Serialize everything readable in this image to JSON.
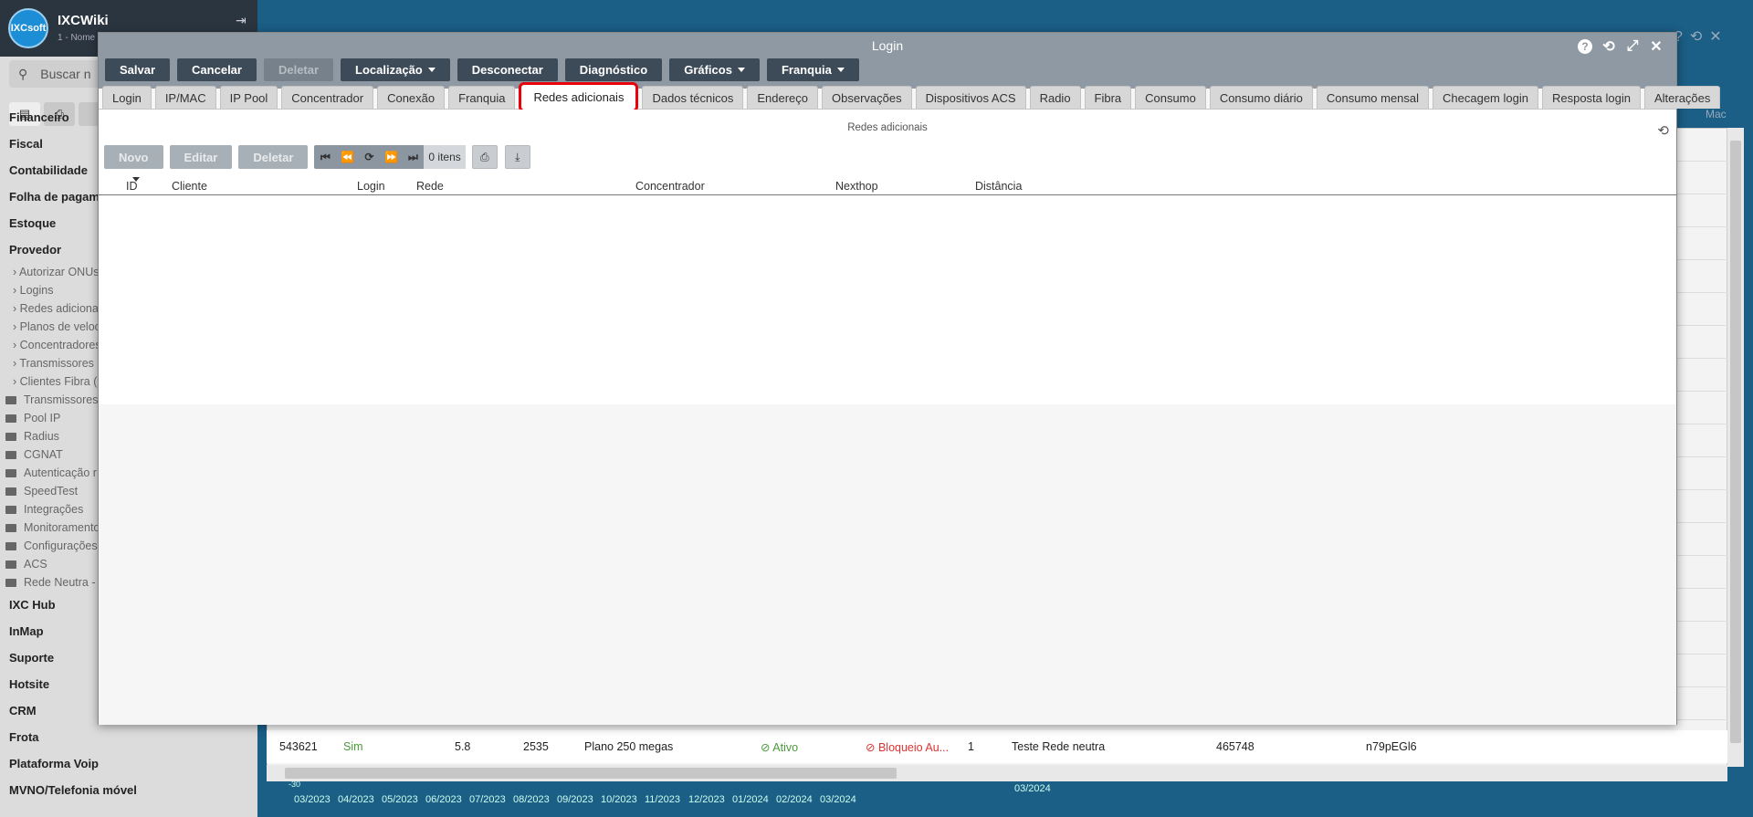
{
  "background": {
    "app_name": "IXCWiki",
    "app_subtitle": "1 - Nome",
    "logo_text": "IXCsoft",
    "search_placeholder": "Buscar n",
    "menu_main_top": [
      "Financeiro",
      "Fiscal",
      "Contabilidade",
      "Folha de pagame",
      "Estoque",
      "Provedor"
    ],
    "menu_sub": [
      "Autorizar ONUs",
      "Logins",
      "Redes adicionais",
      "Planos de veloci",
      "Concentradores",
      "Transmissores (",
      "Clientes Fibra (C"
    ],
    "menu_folders": [
      "Transmissores",
      "Pool IP",
      "Radius",
      "CGNAT",
      "Autenticação r",
      "SpeedTest",
      "Integrações",
      "Monitoramento",
      "Configurações",
      "ACS",
      "Rede Neutra -"
    ],
    "menu_main_bottom": [
      "IXC Hub",
      "InMap",
      "Suporte",
      "Hotsite",
      "CRM",
      "Frota",
      "Plataforma Voip",
      "MVNO/Telefonia móvel"
    ],
    "grid_header_right": "Mac",
    "last_row": {
      "id": "543621",
      "sim": "Sim",
      "v1": "5.8",
      "v2": "2535",
      "plano": "Plano 250 megas",
      "ativo": "Ativo",
      "bloqueio": "Bloqueio Au...",
      "n": "1",
      "rede": "Teste Rede neutra",
      "num": "465748",
      "code": "n79pEGl6"
    },
    "axis_labels": [
      "03/2023",
      "04/2023",
      "05/2023",
      "06/2023",
      "07/2023",
      "08/2023",
      "09/2023",
      "10/2023",
      "11/2023",
      "12/2023",
      "01/2024",
      "02/2024",
      "03/2024"
    ],
    "axis_extra": "03/2024",
    "axis_neg": "-30"
  },
  "modal": {
    "title": "Login",
    "toolbar": {
      "salvar": "Salvar",
      "cancelar": "Cancelar",
      "deletar": "Deletar",
      "localizacao": "Localização",
      "desconectar": "Desconectar",
      "diagnostico": "Diagnóstico",
      "graficos": "Gráficos",
      "franquia": "Franquia"
    },
    "tabs": [
      "Login",
      "IP/MAC",
      "IP Pool",
      "Concentrador",
      "Conexão",
      "Franquia",
      "Redes adicionais",
      "Dados técnicos",
      "Endereço",
      "Observações",
      "Dispositivos ACS",
      "Radio",
      "Fibra",
      "Consumo",
      "Consumo diário",
      "Consumo mensal",
      "Checagem login",
      "Resposta login",
      "Alterações"
    ],
    "active_tab": "Redes adicionais",
    "panel": {
      "title": "Redes adicionais",
      "buttons": {
        "novo": "Novo",
        "editar": "Editar",
        "deletar": "Deletar"
      },
      "item_count": "0 itens",
      "columns": [
        "ID",
        "Cliente",
        "Login",
        "Rede",
        "Concentrador",
        "Nexthop",
        "Distância"
      ]
    }
  }
}
